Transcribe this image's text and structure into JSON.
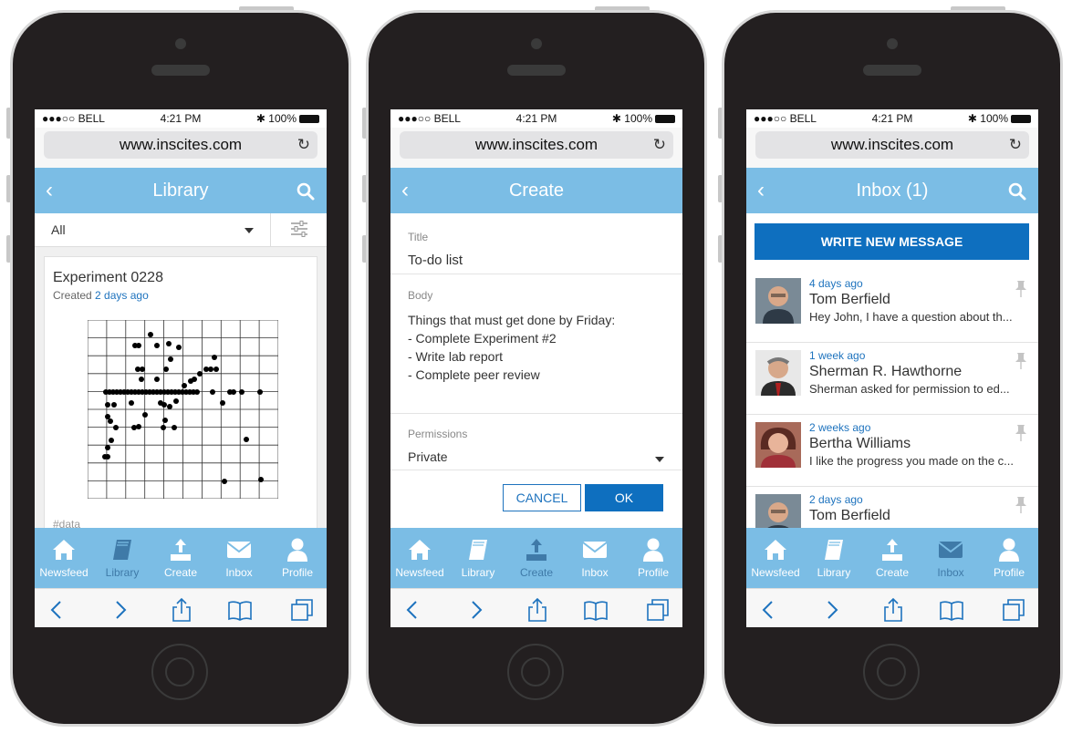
{
  "colors": {
    "accent": "#7bbde5",
    "primary_button": "#0e6fbf",
    "link": "#1e73be",
    "active_tab": "#3f7aa8"
  },
  "phones": [
    {
      "status": {
        "carrier": "●●●○○ BELL",
        "time": "4:21 PM",
        "battery": "100%"
      },
      "url": "www.inscites.com",
      "header": {
        "title": "Library"
      },
      "filter": {
        "selected": "All"
      },
      "card": {
        "title": "Experiment 0228",
        "created_prefix": "Created",
        "created_link": "2 days ago",
        "tag": "#data"
      },
      "tabs": [
        {
          "label": "Newsfeed",
          "icon": "home-icon"
        },
        {
          "label": "Library",
          "icon": "book-icon",
          "active": true
        },
        {
          "label": "Create",
          "icon": "upload-icon"
        },
        {
          "label": "Inbox",
          "icon": "envelope-icon"
        },
        {
          "label": "Profile",
          "icon": "person-icon"
        }
      ]
    },
    {
      "status": {
        "carrier": "●●●○○ BELL",
        "time": "4:21 PM",
        "battery": "100%"
      },
      "url": "www.inscites.com",
      "header": {
        "title": "Create"
      },
      "form": {
        "title_label": "Title",
        "title_value": "To-do list",
        "body_label": "Body",
        "body_lines": [
          "Things that must get done by Friday:",
          "- Complete Experiment #2",
          "- Write lab report",
          "- Complete peer review"
        ],
        "permissions_label": "Permissions",
        "permissions_value": "Private",
        "cancel_label": "CANCEL",
        "ok_label": "OK"
      },
      "tabs": [
        {
          "label": "Newsfeed",
          "icon": "home-icon"
        },
        {
          "label": "Library",
          "icon": "book-icon"
        },
        {
          "label": "Create",
          "icon": "upload-icon",
          "active": true
        },
        {
          "label": "Inbox",
          "icon": "envelope-icon"
        },
        {
          "label": "Profile",
          "icon": "person-icon"
        }
      ]
    },
    {
      "status": {
        "carrier": "●●●○○ BELL",
        "time": "4:21 PM",
        "battery": "100%"
      },
      "url": "www.inscites.com",
      "header": {
        "title": "Inbox (1)"
      },
      "write_button": "WRITE NEW MESSAGE",
      "messages": [
        {
          "time": "4 days ago",
          "name": "Tom Berfield",
          "preview": "Hey John, I have a question about th..."
        },
        {
          "time": "1 week ago",
          "name": "Sherman R. Hawthorne",
          "preview": "Sherman asked for permission to ed..."
        },
        {
          "time": "2 weeks ago",
          "name": "Bertha Williams",
          "preview": "I like the progress you made on the c..."
        },
        {
          "time": "2 days ago",
          "name": "Tom Berfield",
          "preview": ""
        }
      ],
      "tabs": [
        {
          "label": "Newsfeed",
          "icon": "home-icon"
        },
        {
          "label": "Library",
          "icon": "book-icon"
        },
        {
          "label": "Create",
          "icon": "upload-icon"
        },
        {
          "label": "Inbox",
          "icon": "envelope-icon",
          "active": true
        },
        {
          "label": "Profile",
          "icon": "person-icon"
        }
      ]
    }
  ]
}
